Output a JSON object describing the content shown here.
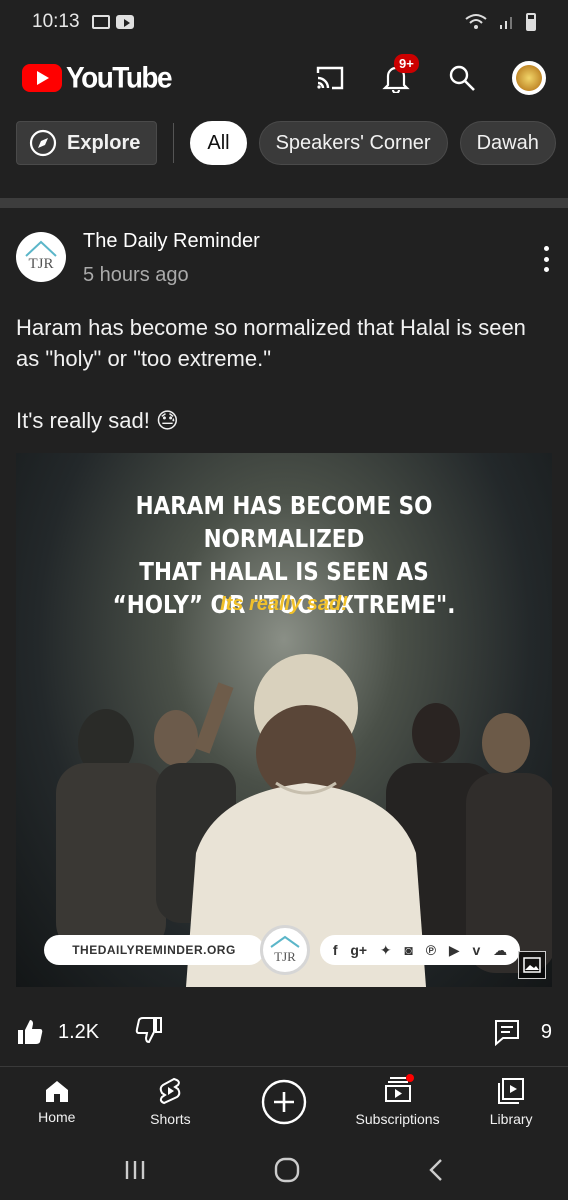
{
  "status_bar": {
    "time": "10:13"
  },
  "app_bar": {
    "logo_text": "YouTube",
    "notification_count": "9+"
  },
  "chips": {
    "explore": "Explore",
    "items": [
      "All",
      "Speakers' Corner",
      "Dawah"
    ],
    "active": "All"
  },
  "post": {
    "channel_name": "The Daily Reminder",
    "channel_initials": "TDR",
    "time_ago": "5 hours ago",
    "text_line1": "Haram has become so normalized that Halal is seen as \"holy\" or \"too extreme.\"",
    "text_line2": "It's really sad! 😓",
    "image": {
      "headline_1": "HARAM HAS BECOME SO NORMALIZED",
      "headline_2": "THAT HALAL IS SEEN AS",
      "headline_3": "“HOLY” OR \"TOO EXTREME\".",
      "subline": "Its really sad!",
      "footer_site": "THEDAILYREMINDER.ORG",
      "footer_logo": "TDR"
    },
    "likes": "1.2K",
    "comments": "9"
  },
  "bottom_nav": {
    "home": "Home",
    "shorts": "Shorts",
    "subscriptions": "Subscriptions",
    "library": "Library"
  },
  "colors": {
    "background": "#212121",
    "brand_red": "#ff0000",
    "accent_yellow": "#f0c02a"
  }
}
